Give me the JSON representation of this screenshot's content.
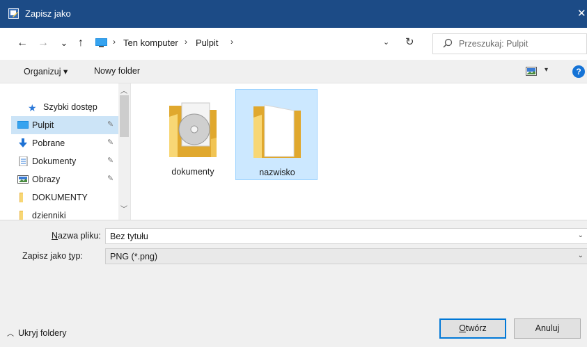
{
  "window": {
    "title": "Zapisz jako",
    "close_glyph": "✕",
    "title_bar_color": "#1c4b86"
  },
  "nav_buttons": {
    "back": "←",
    "forward": "→",
    "recent": "⌄",
    "up": "↑"
  },
  "address": {
    "crumbs": [
      "Ten komputer",
      "Pulpit"
    ],
    "separator": "›",
    "dropdown": "⌄",
    "refresh": "↻"
  },
  "search": {
    "placeholder": "Przeszukaj: Pulpit"
  },
  "toolbar": {
    "organize": "Organizuj ▾",
    "new_folder": "Nowy folder",
    "view_dropdown": "▾",
    "help": "?"
  },
  "sidebar": {
    "quick_access": "Szybki dostęp",
    "items": [
      {
        "label": "Pulpit",
        "icon": "desktop-icon",
        "pinned": true,
        "selected": true
      },
      {
        "label": "Pobrane",
        "icon": "download-icon",
        "pinned": true
      },
      {
        "label": "Dokumenty",
        "icon": "documents-icon",
        "pinned": true
      },
      {
        "label": "Obrazy",
        "icon": "pictures-icon",
        "pinned": true
      },
      {
        "label": "DOKUMENTY",
        "icon": "folder-icon",
        "pinned": false
      },
      {
        "label": "dzienniki",
        "icon": "folder-icon",
        "pinned": false
      }
    ],
    "pin_glyph": "📌",
    "scroll_up": "︿",
    "scroll_down": "﹀"
  },
  "files": [
    {
      "name": "dokumenty",
      "icon": "folder-with-disc-icon",
      "selected": false
    },
    {
      "name": "nazwisko",
      "icon": "folder-icon",
      "selected": true
    }
  ],
  "form": {
    "filename_label_u": "N",
    "filename_label_rest": "azwa pliku:",
    "filename_value": "Bez tytułu",
    "type_label_pre": "Zapisz jako ",
    "type_label_u": "t",
    "type_label_rest": "yp:",
    "type_value": "PNG (*.png)",
    "dropdown": "⌄"
  },
  "footer": {
    "hide_folders": "Ukryj foldery",
    "hide_chevron": "︿",
    "save_u": "O",
    "save_rest": "twórz",
    "cancel": "Anuluj"
  },
  "colors": {
    "selection": "#cce4f7",
    "accent": "#0078d7",
    "folder": "#f8d775"
  }
}
